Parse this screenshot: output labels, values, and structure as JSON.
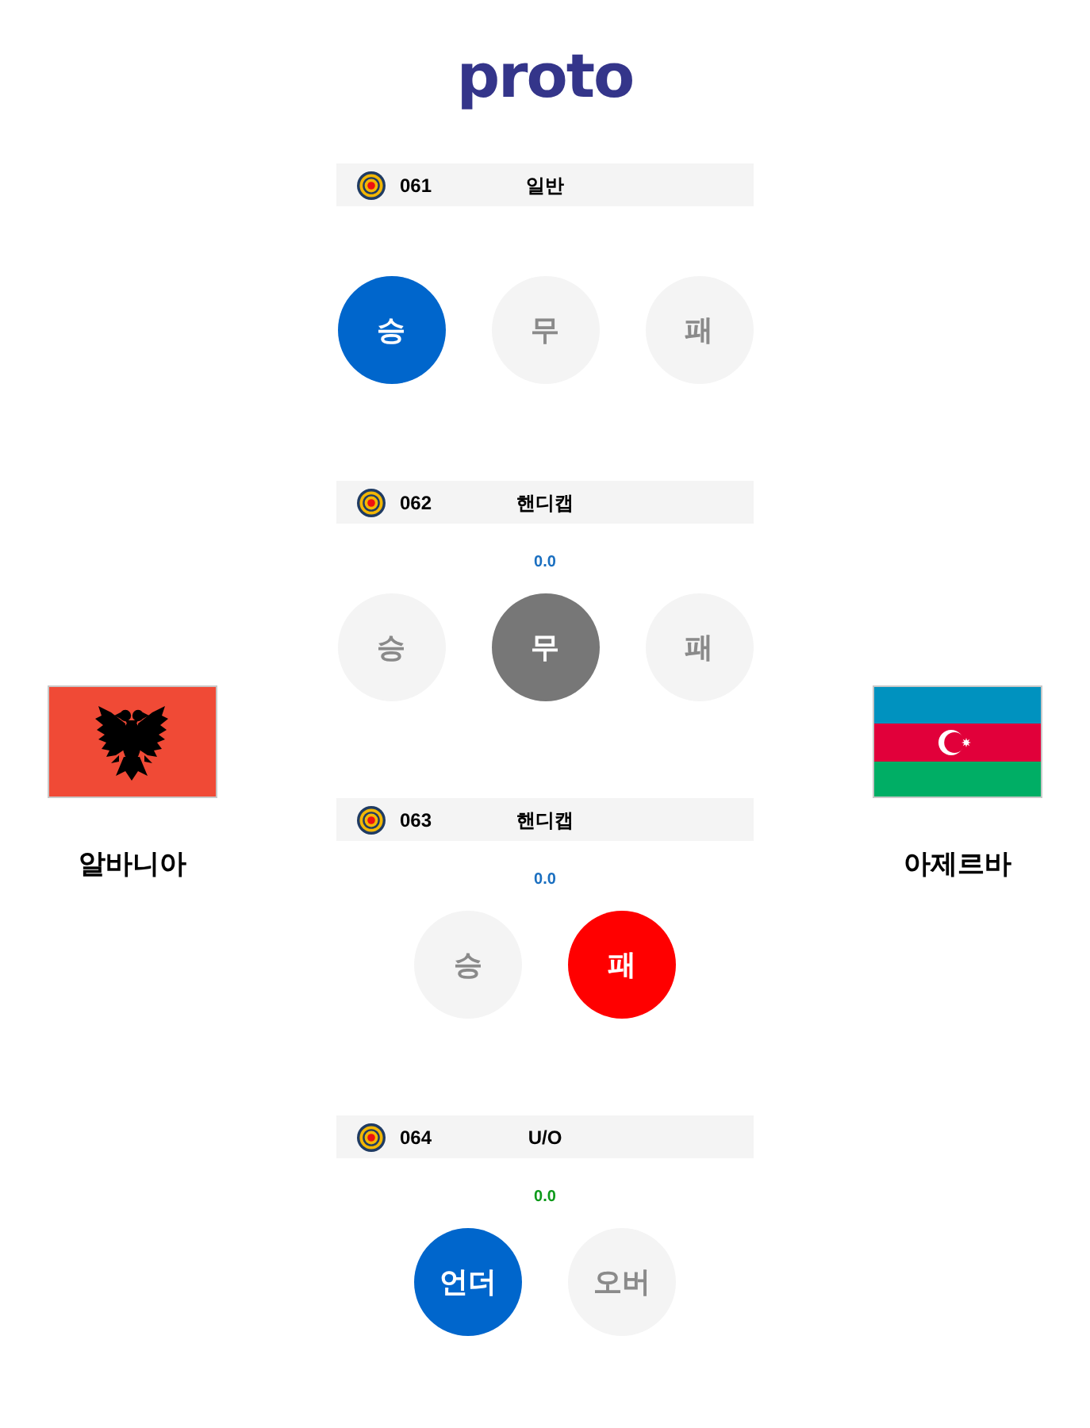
{
  "logo": {
    "text": "proto"
  },
  "teams": [
    {
      "name": "알바니아"
    },
    {
      "name": "아제르바"
    }
  ],
  "markets": [
    {
      "code": "061",
      "type": "일반",
      "kind": "general",
      "options": [
        {
          "label": "승",
          "kind": "win",
          "selected": true
        },
        {
          "label": "무",
          "kind": "draw",
          "selected": false
        },
        {
          "label": "패",
          "kind": "lose",
          "selected": false
        }
      ]
    },
    {
      "code": "062",
      "type": "핸디캡",
      "kind": "handicap",
      "line": "0.0",
      "options": [
        {
          "label": "승",
          "kind": "win",
          "selected": false
        },
        {
          "label": "무",
          "kind": "draw",
          "selected": true
        },
        {
          "label": "패",
          "kind": "lose",
          "selected": false
        }
      ]
    },
    {
      "code": "063",
      "type": "핸디캡",
      "kind": "handicap",
      "line": "0.0",
      "options": [
        {
          "label": "승",
          "kind": "win",
          "selected": false
        },
        {
          "label": "패",
          "kind": "lose",
          "selected": true
        }
      ]
    },
    {
      "code": "064",
      "type": "U/O",
      "kind": "under_over",
      "line": "0.0",
      "options": [
        {
          "label": "언더",
          "kind": "under",
          "selected": true
        },
        {
          "label": "오버",
          "kind": "over",
          "selected": false
        }
      ]
    }
  ]
}
